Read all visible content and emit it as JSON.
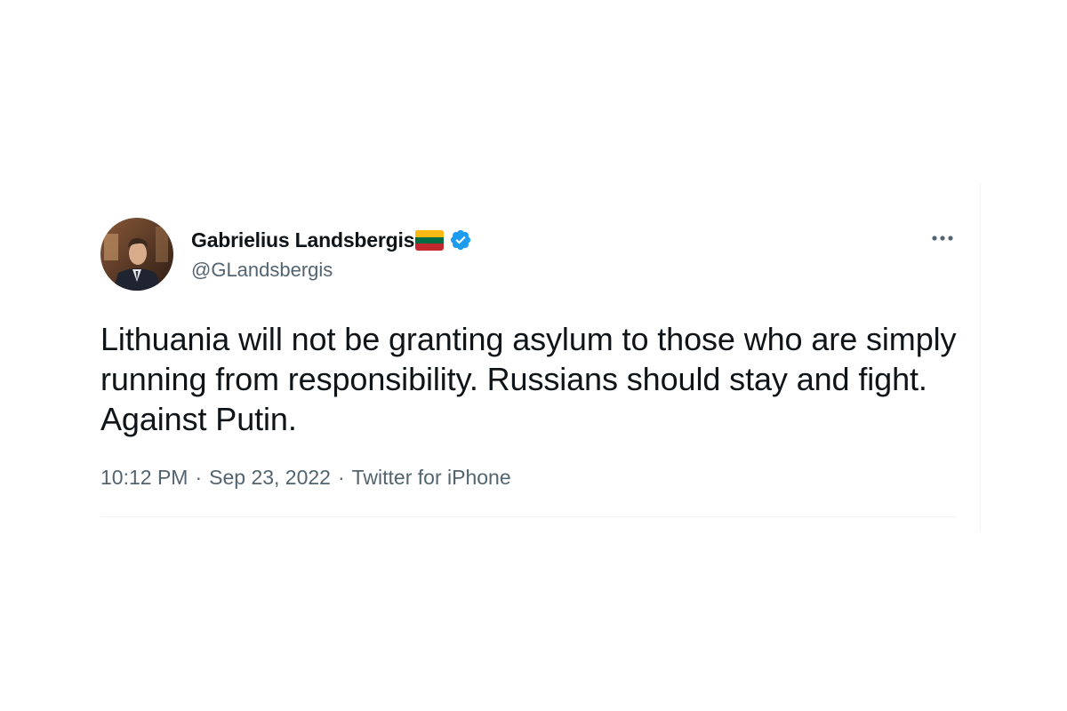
{
  "tweet": {
    "display_name": "Gabrielius Landsbergis",
    "handle": "@GLandsbergis",
    "text": "Lithuania will not be granting asylum to those who are simply running from responsibility. Russians should stay and fight. Against Putin.",
    "time": "10:12 PM",
    "separator": "·",
    "date": "Sep 23, 2022",
    "source": "Twitter for iPhone",
    "icons": {
      "flag": "lithuania-flag-emoji",
      "verified": "verified-badge-icon",
      "more": "more-options-icon",
      "avatar": "profile-avatar"
    }
  },
  "colors": {
    "text_primary": "#0f1419",
    "text_secondary": "#536471",
    "verified_blue": "#1d9bf0",
    "divider": "#eff3f4",
    "flag_yellow": "#fdb913",
    "flag_green": "#006a44",
    "flag_red": "#c1272d"
  }
}
